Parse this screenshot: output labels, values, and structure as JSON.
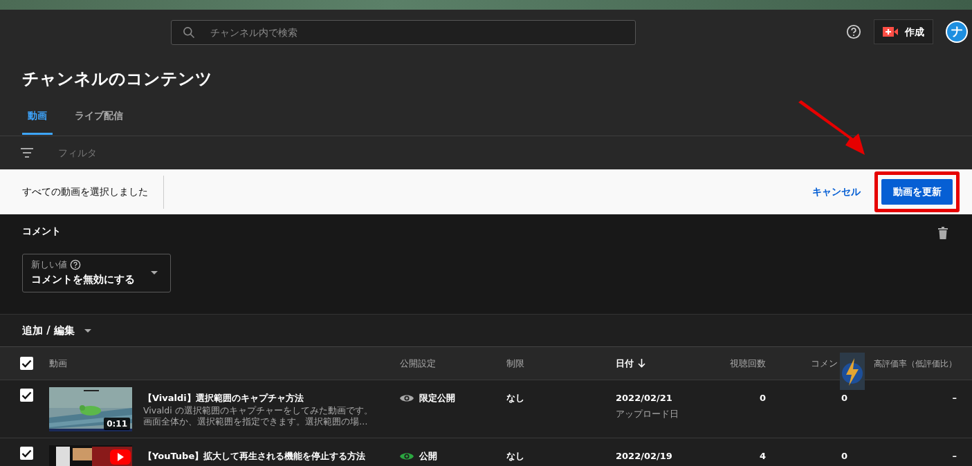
{
  "search": {
    "placeholder": "チャンネル内で検索"
  },
  "create_button": "作成",
  "avatar": "ナ",
  "page_title": "チャンネルのコンテンツ",
  "tabs": [
    {
      "label": "動画",
      "selected": true
    },
    {
      "label": "ライブ配信",
      "selected": false
    }
  ],
  "filter": {
    "placeholder": "フィルタ"
  },
  "selection_bar": {
    "message": "すべての動画を選択しました",
    "cancel": "キャンセル",
    "update_button": "動画を更新"
  },
  "edit_panel": {
    "title": "コメント",
    "field_label": "新しい値",
    "value": "コメントを無効にする"
  },
  "add_edit": "追加 / 編集",
  "table": {
    "select_all_checked": true,
    "columns": [
      {
        "label": "動画",
        "sorted": false
      },
      {
        "label": "公開設定",
        "sorted": false
      },
      {
        "label": "制限",
        "sorted": false
      },
      {
        "label": "日付",
        "sorted": true
      },
      {
        "label": "視聴回数",
        "sorted": false
      },
      {
        "label": "コメン",
        "sorted": false
      },
      {
        "label": "高評価率（低評価比）",
        "sorted": false
      }
    ],
    "rows": [
      {
        "checked": true,
        "title": "【Vivaldi】選択範囲のキャプチャ方法",
        "description": [
          "Vivaldi の選択範囲のキャプチャーをしてみた動画です。",
          "画面全体か、選択範囲を指定できます。選択範囲の場…"
        ],
        "duration": "0:11",
        "visibility": {
          "kind": "unlisted",
          "label": "限定公開"
        },
        "restriction": "なし",
        "date": "2022/02/21",
        "date_note": "アップロード日",
        "views": "0",
        "comments": "0",
        "rating": "–"
      },
      {
        "checked": true,
        "title": "【YouTube】拡大して再生される機能を停止する方法",
        "visibility": {
          "kind": "public",
          "label": "公開"
        },
        "restriction": "なし",
        "date": "2022/02/19",
        "views": "4",
        "comments": "0",
        "rating": "–"
      }
    ]
  }
}
